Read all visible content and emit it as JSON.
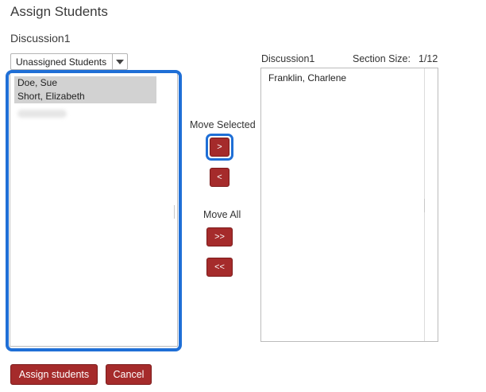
{
  "page": {
    "title": "Assign Students",
    "section_name": "Discussion1"
  },
  "filter": {
    "selected": "Unassigned Students"
  },
  "unassigned_list": {
    "items": [
      {
        "name": "Doe, Sue",
        "selected": true
      },
      {
        "name": "Short, Elizabeth",
        "selected": true
      }
    ]
  },
  "controls": {
    "move_selected_label": "Move Selected",
    "move_right": ">",
    "move_left": "<",
    "move_all_label": "Move All",
    "move_all_right": ">>",
    "move_all_left": "<<"
  },
  "target": {
    "section_name": "Discussion1",
    "section_size_label": "Section Size:",
    "section_size_value": "1/12",
    "items": [
      {
        "name": "Franklin, Charlene"
      }
    ]
  },
  "footer": {
    "assign_label": "Assign students",
    "cancel_label": "Cancel"
  },
  "colors": {
    "button": "#a52b2b",
    "highlight": "#1f6fd6",
    "selection": "#d2d2d2"
  }
}
